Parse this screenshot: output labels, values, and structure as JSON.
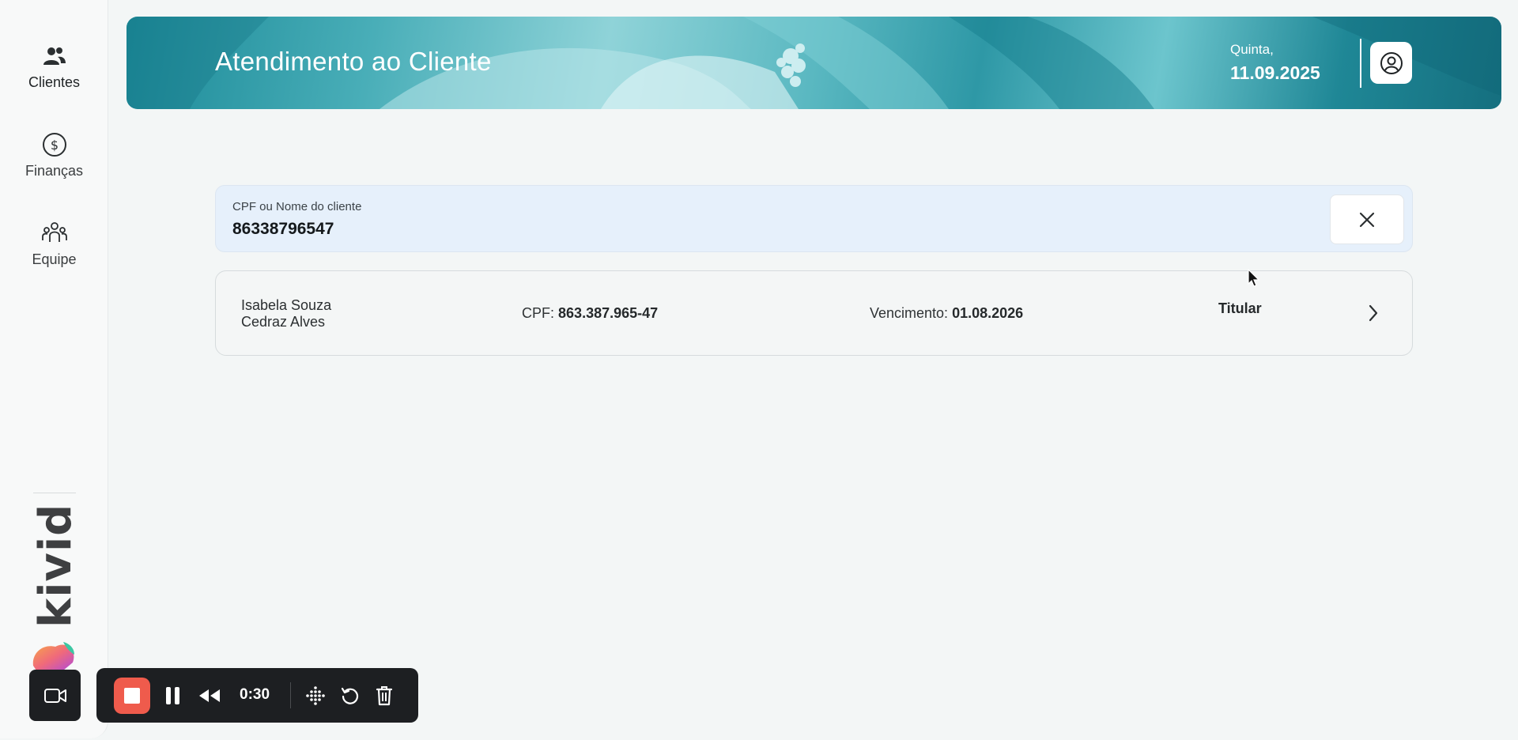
{
  "sidebar": {
    "items": [
      {
        "label": "Clientes",
        "icon": "users-icon",
        "active": true
      },
      {
        "label": "Finanças",
        "icon": "dollar-circle-icon",
        "active": false
      },
      {
        "label": "Equipe",
        "icon": "team-icon",
        "active": false
      }
    ],
    "brand": "kivid"
  },
  "header": {
    "title": "Atendimento ao Cliente",
    "day": "Quinta,",
    "date": "11.09.2025",
    "profile_icon": "user-circle-icon"
  },
  "search": {
    "label": "CPF ou Nome do cliente",
    "value": "86338796547",
    "clear_icon": "close-icon"
  },
  "results": [
    {
      "name_line1": "Isabela Souza",
      "name_line2": "Cedraz Alves",
      "cpf_label": "CPF:",
      "cpf": "863.387.965-47",
      "venc_label": "Vencimento:",
      "venc": "01.08.2026",
      "role": "Titular"
    }
  ],
  "recorder": {
    "time": "0:30"
  },
  "colors": {
    "banner": "#2e98a6",
    "record": "#ef5b4c",
    "search_bg": "#e6f0fb"
  }
}
